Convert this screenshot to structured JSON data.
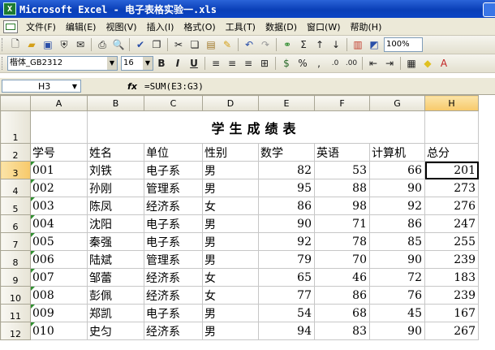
{
  "window": {
    "title": "Microsoft Excel - 电子表格实验一.xls",
    "app_icon": "excel-icon"
  },
  "menu": [
    "文件(F)",
    "编辑(E)",
    "视图(V)",
    "插入(I)",
    "格式(O)",
    "工具(T)",
    "数据(D)",
    "窗口(W)",
    "帮助(H)"
  ],
  "toolbar": {
    "zoom": "100%",
    "font_name": "楷体_GB2312",
    "font_size": "16"
  },
  "formula_bar": {
    "name_box": "H3",
    "fx": "fx",
    "formula": "=SUM(E3:G3)"
  },
  "sheet": {
    "columns": [
      "A",
      "B",
      "C",
      "D",
      "E",
      "F",
      "G",
      "H"
    ],
    "row_numbers": [
      "1",
      "2",
      "3",
      "4",
      "5",
      "6",
      "7",
      "8",
      "9",
      "10",
      "11",
      "12"
    ],
    "title": "学生成绩表",
    "headers": [
      "学号",
      "姓名",
      "单位",
      "性别",
      "数学",
      "英语",
      "计算机",
      "总分"
    ],
    "rows": [
      [
        "001",
        "刘铁",
        "电子系",
        "男",
        "82",
        "53",
        "66",
        "201"
      ],
      [
        "002",
        "孙刚",
        "管理系",
        "男",
        "95",
        "88",
        "90",
        "273"
      ],
      [
        "003",
        "陈凤",
        "经济系",
        "女",
        "86",
        "98",
        "92",
        "276"
      ],
      [
        "004",
        "沈阳",
        "电子系",
        "男",
        "90",
        "71",
        "86",
        "247"
      ],
      [
        "005",
        "秦强",
        "电子系",
        "男",
        "92",
        "78",
        "85",
        "255"
      ],
      [
        "006",
        "陆斌",
        "管理系",
        "男",
        "79",
        "70",
        "90",
        "239"
      ],
      [
        "007",
        "邹蕾",
        "经济系",
        "女",
        "65",
        "46",
        "72",
        "183"
      ],
      [
        "008",
        "彭佩",
        "经济系",
        "女",
        "77",
        "86",
        "76",
        "239"
      ],
      [
        "009",
        "郑凯",
        "电子系",
        "男",
        "54",
        "68",
        "45",
        "167"
      ],
      [
        "010",
        "史匀",
        "经济系",
        "男",
        "94",
        "83",
        "90",
        "267"
      ]
    ]
  }
}
